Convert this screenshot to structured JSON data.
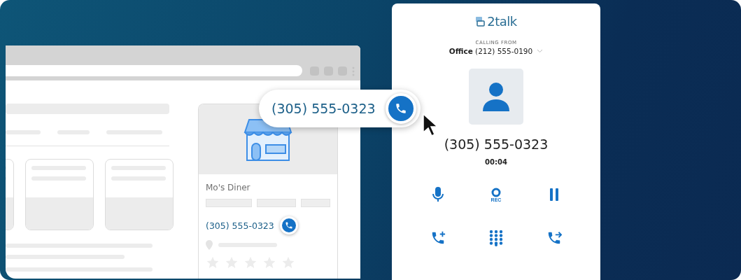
{
  "browser": {
    "business_card": {
      "name": "Mo's Diner",
      "phone": "(305) 555-0323"
    }
  },
  "callout": {
    "phone": "(305) 555-0323"
  },
  "dialer": {
    "logo": "2talk",
    "calling_from_label": "CALLING FROM",
    "line": "**Office** (212) 555-0190",
    "callee": "(305) 555-0323",
    "timer": "00:04",
    "controls": [
      {
        "kind": "mute"
      },
      {
        "kind": "record",
        "label": "REC"
      },
      {
        "kind": "hold"
      },
      {
        "kind": "add"
      },
      {
        "kind": "keypad"
      },
      {
        "kind": "transfer"
      }
    ]
  }
}
